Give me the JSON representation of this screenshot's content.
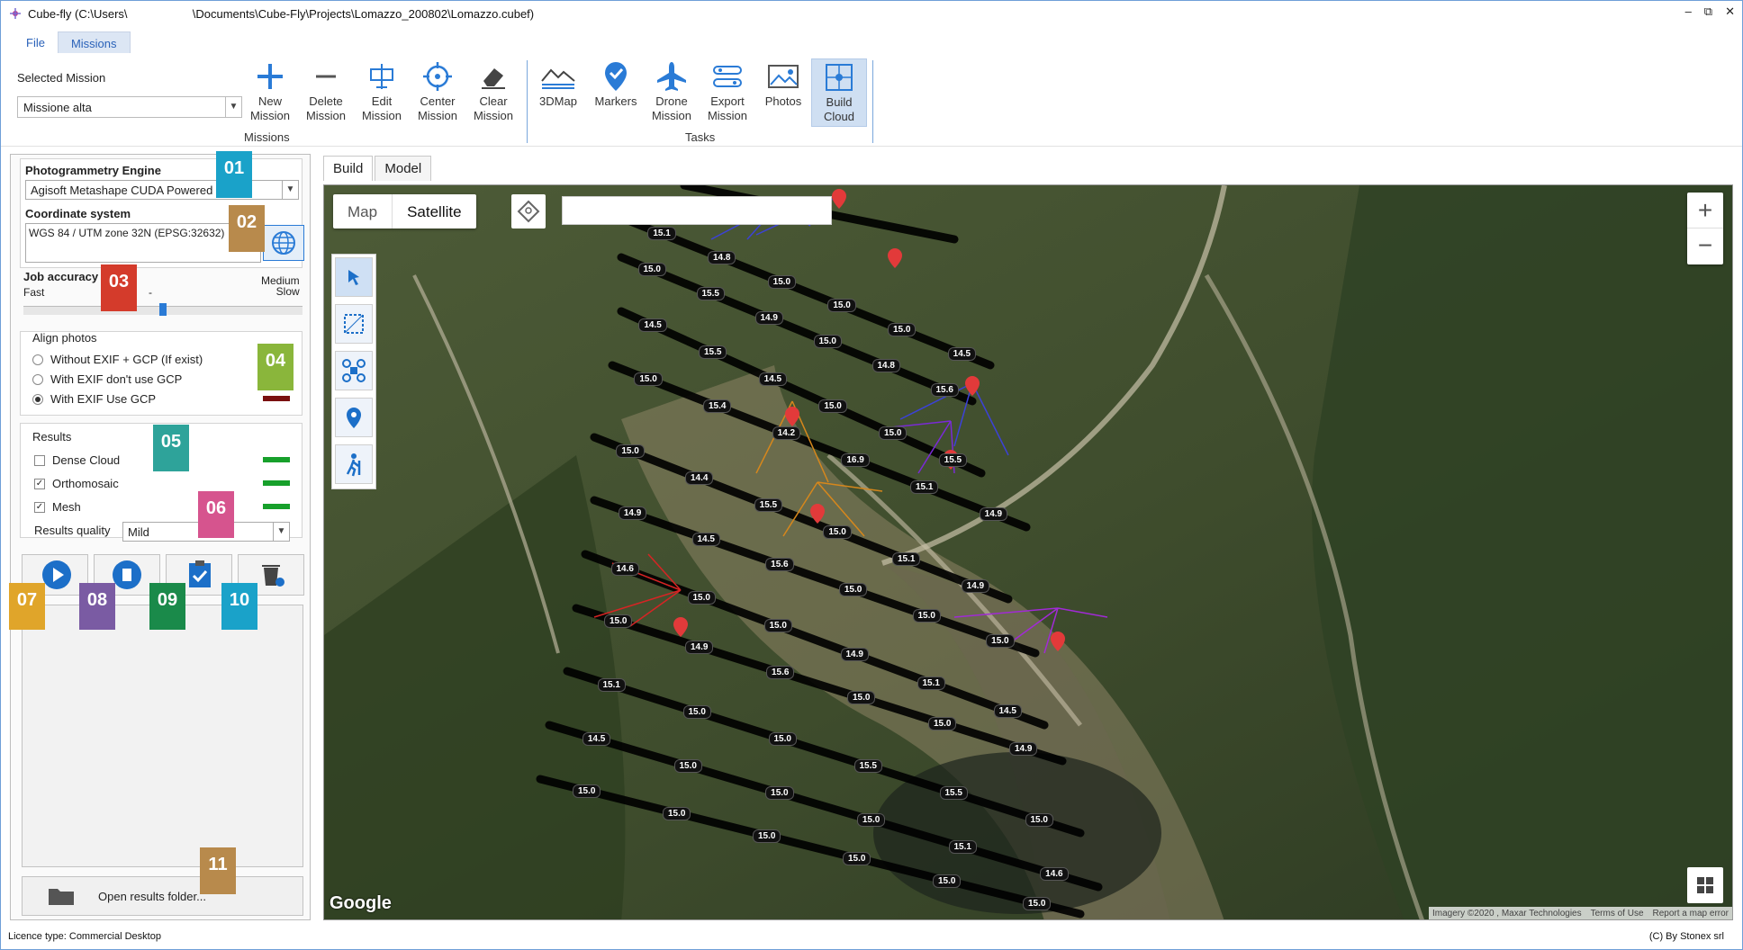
{
  "window": {
    "title": "Cube-fly (C:\\Users\\                    \\Documents\\Cube-Fly\\Projects\\Lomazzo_200802\\Lomazzo.cubef)",
    "controls": [
      "–",
      "⧉",
      "✕"
    ]
  },
  "menu": {
    "tabs": [
      {
        "label": "File"
      },
      {
        "label": "Missions"
      }
    ]
  },
  "ribbon": {
    "selected_mission_label": "Selected Mission",
    "selected_mission_value": "Missione alta",
    "missions_buttons": [
      {
        "label1": "New",
        "label2": "Mission",
        "icon": "plus-icon"
      },
      {
        "label1": "Delete",
        "label2": "Mission",
        "icon": "minus-icon"
      },
      {
        "label1": "Edit",
        "label2": "Mission",
        "icon": "edit-mission-icon"
      },
      {
        "label1": "Center",
        "label2": "Mission",
        "icon": "crosshair-icon"
      },
      {
        "label1": "Clear",
        "label2": "Mission",
        "icon": "eraser-icon"
      }
    ],
    "missions_group": "Missions",
    "tasks_buttons": [
      {
        "label1": "3DMap",
        "label2": "",
        "icon": "3dmap-icon"
      },
      {
        "label1": "Markers",
        "label2": "",
        "icon": "marker-icon"
      },
      {
        "label1": "Drone",
        "label2": "Mission",
        "icon": "plane-icon"
      },
      {
        "label1": "Export",
        "label2": "Mission",
        "icon": "export-icon"
      },
      {
        "label1": "Photos",
        "label2": "",
        "icon": "photo-icon"
      },
      {
        "label1": "Build",
        "label2": "Cloud",
        "icon": "build-cloud-icon"
      }
    ],
    "tasks_group": "Tasks"
  },
  "left": {
    "engine_label": "Photogrammetry Engine",
    "engine_value": "Agisoft Metashape CUDA Powered",
    "coord_label": "Coordinate system",
    "coord_value": "WGS 84 / UTM zone 32N (EPSG:32632)",
    "accuracy_label": "Job accuracy",
    "accuracy_fast": "Fast",
    "accuracy_mid": "-",
    "accuracy_medium": "Medium",
    "accuracy_slow": "Slow",
    "accuracy_level": 0.5,
    "align_label": "Align photos",
    "align_options": [
      {
        "label": "Without EXIF + GCP (If exist)",
        "selected": false
      },
      {
        "label": "With EXIF don't use GCP",
        "selected": false
      },
      {
        "label": "With EXIF Use GCP",
        "selected": true
      }
    ],
    "results_label": "Results",
    "results": [
      {
        "label": "Dense Cloud",
        "checked": false
      },
      {
        "label": "Orthomosaic",
        "checked": true
      },
      {
        "label": "Mesh",
        "checked": true
      }
    ],
    "quality_label": "Results quality",
    "quality_value": "Mild",
    "open_results": "Open results folder...",
    "badges": [
      "01",
      "02",
      "03",
      "04",
      "05",
      "06",
      "07",
      "08",
      "09",
      "10",
      "11"
    ]
  },
  "view_tabs": [
    {
      "label": "Build"
    },
    {
      "label": "Model"
    }
  ],
  "map": {
    "type_map": "Map",
    "type_satellite": "Satellite",
    "zoom_in": "+",
    "zoom_out": "−",
    "google": "Google",
    "attribution": [
      "Imagery ©2020 , Maxar Technologies",
      "Terms of Use",
      "Report a map error"
    ],
    "waypoints": [
      "15.1",
      "14.8",
      "15.0",
      "15.0",
      "15.0",
      "14.5",
      "15.0",
      "15.5",
      "14.9",
      "15.0",
      "14.8",
      "15.6",
      "14.5",
      "15.5",
      "14.5",
      "15.0",
      "15.0",
      "15.5",
      "15.0",
      "15.4",
      "14.2",
      "16.9",
      "15.1",
      "14.9",
      "15.0",
      "14.4",
      "15.5",
      "15.0",
      "15.1",
      "14.9",
      "14.9",
      "14.5",
      "15.6",
      "15.0",
      "15.0",
      "15.0",
      "14.6",
      "15.0",
      "15.0",
      "14.9",
      "15.1",
      "14.5",
      "15.0",
      "14.9",
      "15.6",
      "15.0",
      "15.0",
      "14.9",
      "15.1",
      "15.0",
      "15.0",
      "15.5",
      "15.5",
      "15.0",
      "14.5",
      "15.0",
      "15.0",
      "15.0",
      "15.1",
      "14.6",
      "15.0",
      "15.0",
      "15.0",
      "15.0",
      "15.0",
      "15.0",
      "15.0"
    ]
  },
  "status": {
    "licence": "Licence type: Commercial Desktop",
    "copyright": "(C) By Stonex srl"
  }
}
